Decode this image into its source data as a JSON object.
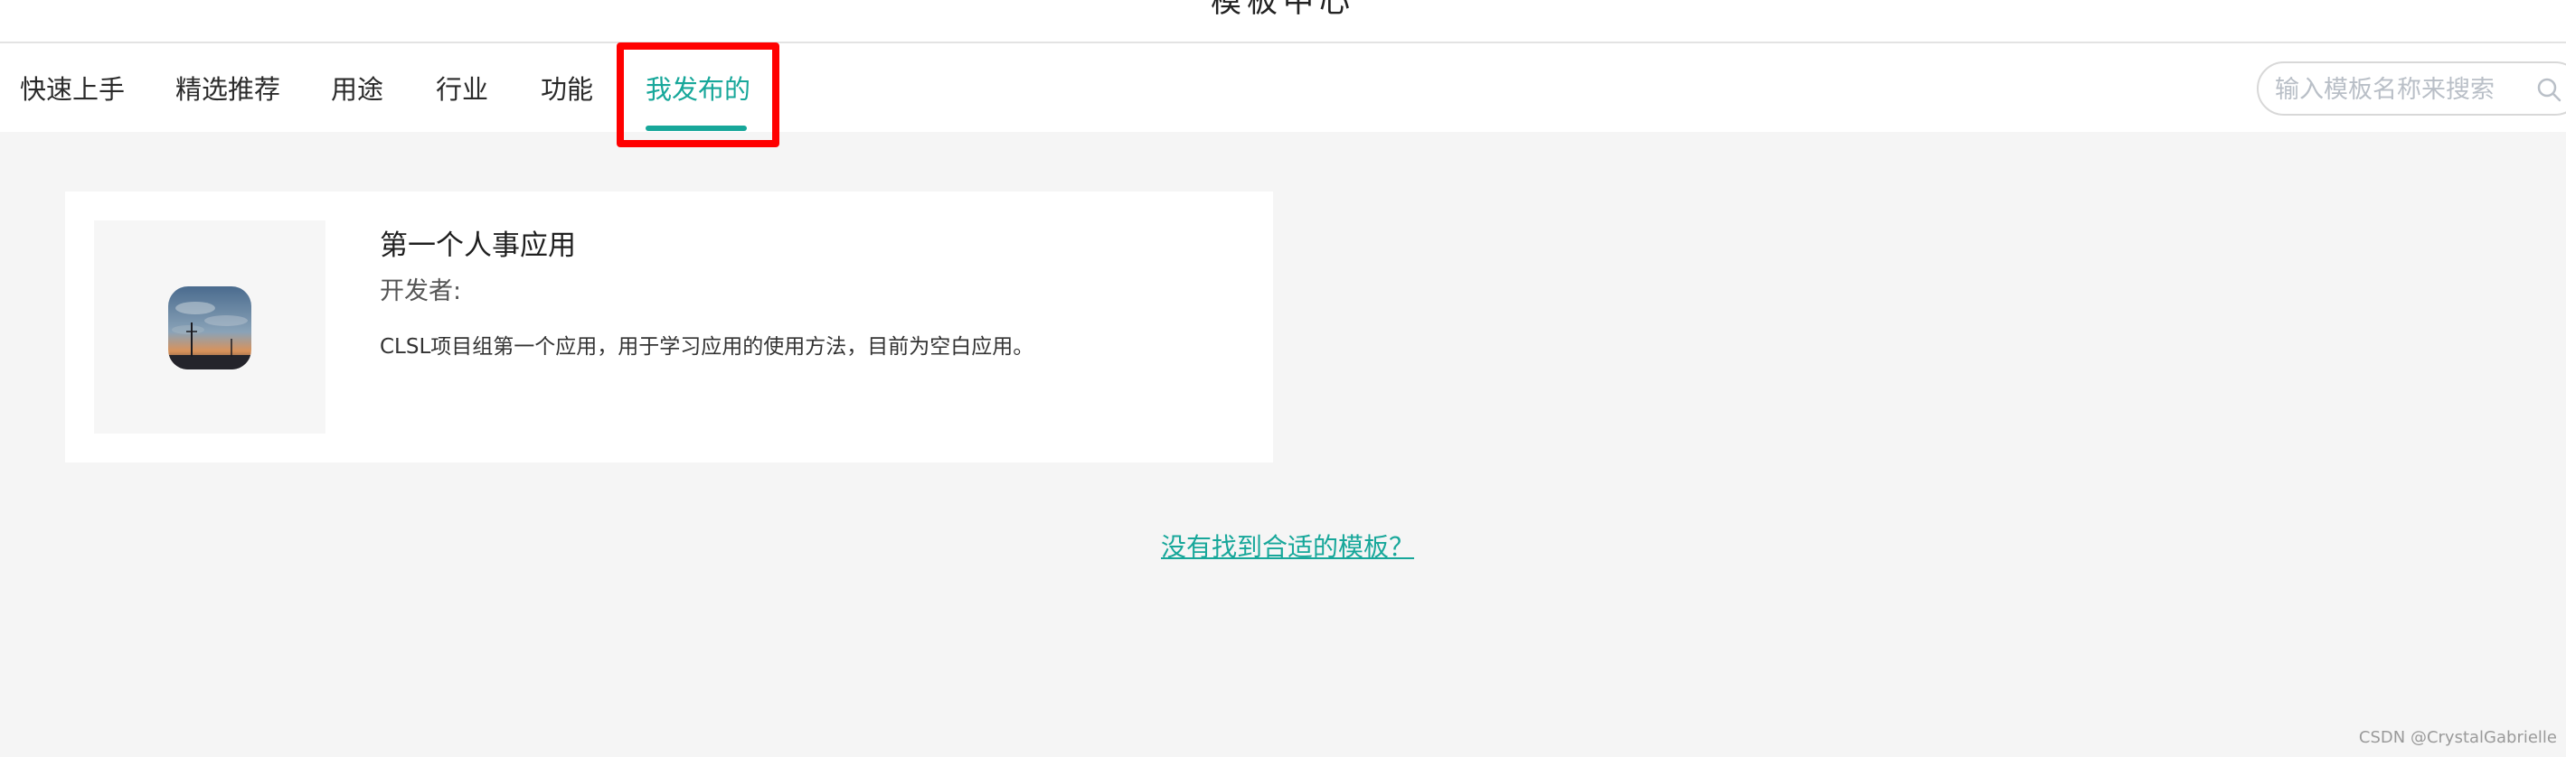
{
  "header": {
    "title": "模板中心"
  },
  "tabs": [
    {
      "label": "快速上手"
    },
    {
      "label": "精选推荐"
    },
    {
      "label": "用途"
    },
    {
      "label": "行业"
    },
    {
      "label": "功能"
    },
    {
      "label": "我发布的",
      "active": true
    }
  ],
  "search": {
    "placeholder": "输入模板名称来搜索",
    "icon": "search-icon"
  },
  "template_card": {
    "name": "第一个人事应用",
    "developer_label": "开发者:",
    "description": "CLSL项目组第一个应用，用于学习应用的使用方法，目前为空白应用。",
    "icon": "app-landscape-icon"
  },
  "footer": {
    "not_found_link": "没有找到合适的模板？"
  },
  "watermark": "CSDN @CrystalGabrielle",
  "colors": {
    "accent": "#17a79a",
    "highlight": "#ff0000",
    "background": "#f5f5f5"
  }
}
